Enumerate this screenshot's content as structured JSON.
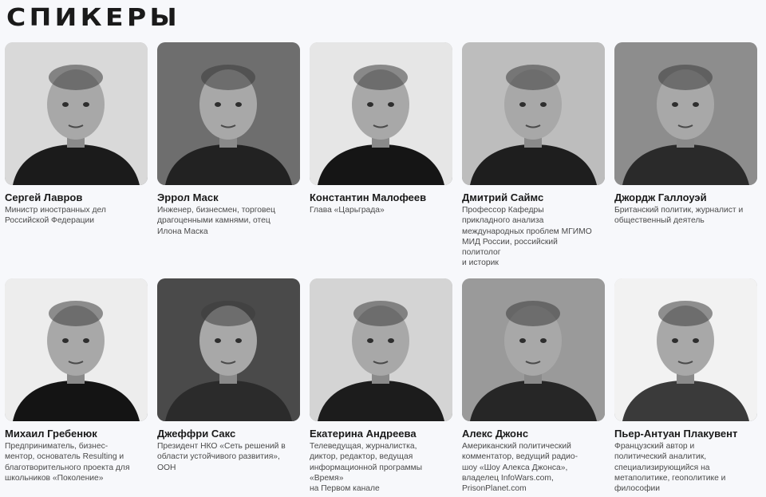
{
  "section": {
    "title": "СПИКЕРЫ"
  },
  "speakers": [
    {
      "name": "Сергей Лавров",
      "role": "Министр иностранных дел\nРоссийской Федерации",
      "bg": "#d9d9d9",
      "shirt": "#1b1b1b"
    },
    {
      "name": "Эррол Маск",
      "role": "Инженер, бизнесмен, торговец\nдрагоценными камнями, отец\nИлона Маска",
      "bg": "#6e6e6e",
      "shirt": "#222222"
    },
    {
      "name": "Константин Малофеев",
      "role": "Глава «Царьграда»",
      "bg": "#e6e6e6",
      "shirt": "#151515"
    },
    {
      "name": "Дмитрий Саймс",
      "role": "Профессор Кафедры\nприкладного анализа\nмеждународных проблем МГИМО\nМИД России, российский\nполитолог\nи историк",
      "bg": "#bdbdbd",
      "shirt": "#1e1e1e"
    },
    {
      "name": "Джордж Галлоуэй",
      "role": "Британский политик, журналист и\nобщественный деятель",
      "bg": "#8d8d8d",
      "shirt": "#2a2a2a"
    },
    {
      "name": "Михаил Гребенюк",
      "role": "Предприниматель, бизнес-\nментор, основатель Resulting и\nблаготворительного проекта для\nшкольников «Поколение»",
      "bg": "#ededed",
      "shirt": "#141414"
    },
    {
      "name": "Джеффри Сакс",
      "role": "Президент НКО «Сеть решений в\nобласти устойчивого развития»,\nООН",
      "bg": "#4a4a4a",
      "shirt": "#2b2b2b"
    },
    {
      "name": "Екатерина Андреева",
      "role": "Телеведущая, журналистка,\nдиктор, редактор, ведущая\nинформационной программы\n«Время»\nна Первом канале",
      "bg": "#d4d4d4",
      "shirt": "#1c1c1c"
    },
    {
      "name": "Алекс Джонс",
      "role": "Американский политический\nкомментатор, ведущий радио-\nшоу «Шоу Алекса Джонса»,\nвладелец InfoWars.com,\nPrisonPlanet.com",
      "bg": "#9a9a9a",
      "shirt": "#262626"
    },
    {
      "name": "Пьер-Антуан Плакувент",
      "role": "Французский автор и\nполитический аналитик,\nспециализирующийся на\nметаполитике, геополитике и\nфилософии",
      "bg": "#f2f2f2",
      "shirt": "#3a3a3a"
    }
  ]
}
